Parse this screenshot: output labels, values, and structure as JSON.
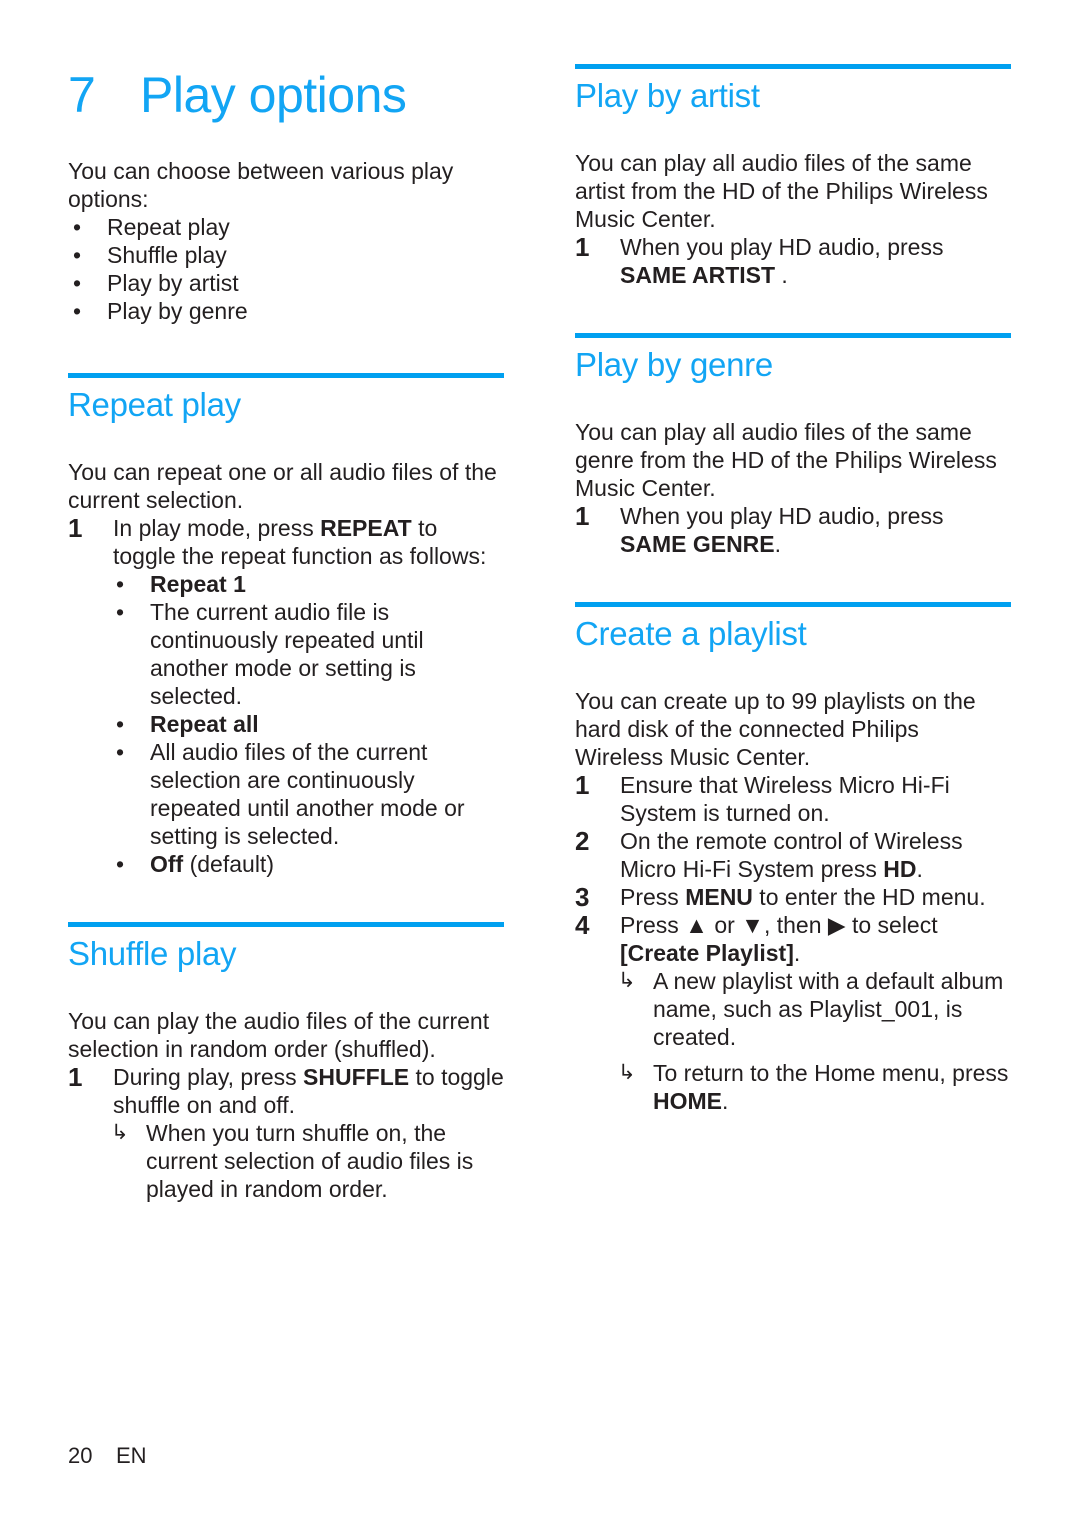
{
  "chapter": {
    "number": "7",
    "title": "Play options"
  },
  "left_column": {
    "intro": {
      "paragraph": "You can choose between various play options:",
      "bullet": "•",
      "items": [
        "Repeat play",
        "Shuffle play",
        "Play by artist",
        "Play by genre"
      ]
    },
    "repeat_play": {
      "heading": "Repeat play",
      "paragraph": "You can repeat one or all audio files of the current selection.",
      "step_number": "1",
      "step_text_before": "In play mode, press ",
      "step_key": "REPEAT",
      "step_text_after": " to toggle the repeat function as follows:",
      "bullet": "•",
      "modes": [
        {
          "bold": "Repeat 1",
          "rest": ""
        },
        {
          "bold": "",
          "rest": "The current audio file is continuously repeated until another mode or setting is selected."
        },
        {
          "bold": "Repeat all",
          "rest": ""
        },
        {
          "bold": "",
          "rest": "All audio files of the current selection are continuously repeated until another mode or setting is selected."
        },
        {
          "bold": "Off",
          "rest": " (default)"
        }
      ]
    },
    "shuffle_play": {
      "heading": "Shuffle play",
      "paragraph": "You can play the audio files of the current selection in random order (shuffled).",
      "step_number": "1",
      "step_text_before": "During play, press ",
      "step_key": "SHUFFLE",
      "step_text_after": " to toggle shuffle on and off.",
      "arrow": "↳",
      "result": "When you turn shuffle on, the current selection of audio files is played in random order."
    }
  },
  "right_column": {
    "play_by_artist": {
      "heading": "Play by artist",
      "paragraph": "You can play all audio files of the same artist from the HD of the Philips Wireless Music Center.",
      "step_number": "1",
      "step_text_before": "When you play HD audio, press ",
      "step_key": "SAME ARTIST",
      "step_text_after": " ."
    },
    "play_by_genre": {
      "heading": "Play by genre",
      "paragraph": "You can play all audio files of the same genre from the HD of the Philips Wireless Music Center.",
      "step_number": "1",
      "step_text_before": "When you play HD audio, press ",
      "step_key": "SAME GENRE",
      "step_text_after": "."
    },
    "create_a_playlist": {
      "heading": "Create a playlist",
      "paragraph": "You can create up to 99 playlists on the hard disk of the connected Philips Wireless Music Center.",
      "steps": [
        {
          "number": "1",
          "before": "Ensure that Wireless Micro Hi-Fi System is turned on.",
          "key": "",
          "after": ""
        },
        {
          "number": "2",
          "before": "On the remote control of Wireless Micro Hi-Fi System press ",
          "key": "HD",
          "after": "."
        },
        {
          "number": "3",
          "before": "Press ",
          "key": "MENU",
          "after": " to enter the HD menu."
        },
        {
          "number": "4",
          "before": "Press ▲ or ▼, then ▶ to select ",
          "key": "[Create Playlist]",
          "after": "."
        }
      ],
      "arrow": "↳",
      "results": [
        {
          "before": "A new playlist with a default album name, such as Playlist_001, is created.",
          "key": "",
          "after": ""
        },
        {
          "before": "To return to the Home menu, press ",
          "key": "HOME",
          "after": "."
        }
      ]
    }
  },
  "footer": {
    "page_number": "20",
    "language": "EN"
  }
}
